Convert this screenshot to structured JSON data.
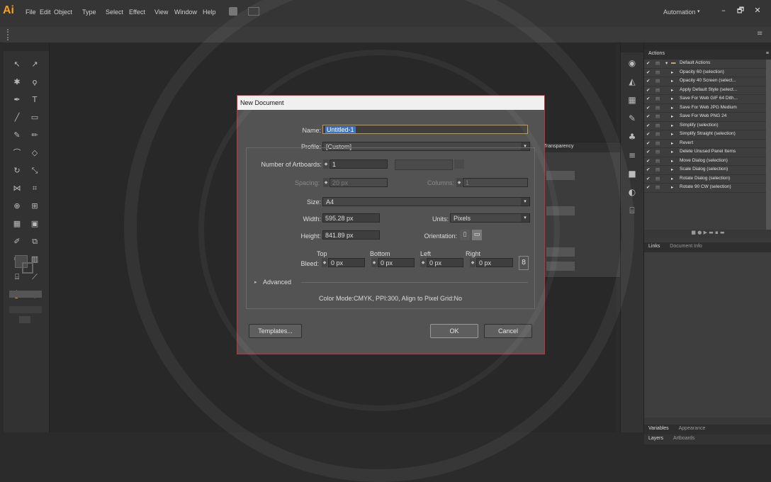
{
  "app": {
    "logo": "Ai",
    "menu": [
      "File",
      "Edit",
      "Object",
      "Type",
      "Select",
      "Effect",
      "View",
      "Window",
      "Help"
    ],
    "workspace": "Automation",
    "window_buttons": [
      "–",
      "🗗",
      "✕"
    ]
  },
  "dialog": {
    "title": "New Document",
    "name_label": "Name:",
    "name_value": "Untitled-1",
    "profile_label": "Profile:",
    "profile_value": "[Custom]",
    "artboards_label": "Number of Artboards:",
    "artboards_value": "1",
    "spacing_label": "Spacing:",
    "spacing_value": "20 px",
    "columns_label": "Columns:",
    "columns_value": "1",
    "size_label": "Size:",
    "size_value": "A4",
    "width_label": "Width:",
    "width_value": "595.28 px",
    "units_label": "Units:",
    "units_value": "Pixels",
    "height_label": "Height:",
    "height_value": "841.89 px",
    "orientation_label": "Orientation:",
    "bleed_label": "Bleed:",
    "bleed_headers": [
      "Top",
      "Bottom",
      "Left",
      "Right"
    ],
    "bleed_values": [
      "0 px",
      "0 px",
      "0 px",
      "0 px"
    ],
    "advanced_label": "Advanced",
    "info": "Color Mode:CMYK, PPI:300, Align to Pixel Grid:No",
    "templates_button": "Templates...",
    "ok_button": "OK",
    "cancel_button": "Cancel"
  },
  "actions_panel": {
    "tab": "Actions",
    "set_name": "Default Actions",
    "items": [
      "Opacity 60 (selection)",
      "Opacity 40 Screen (select...",
      "Apply Default Style (select...",
      "Save For Web GIF 64 Dith...",
      "Save For Web JPG Medium",
      "Save For Web PNG 24",
      "Simplify (selection)",
      "Simplify Straight (selection)",
      "Revert",
      "Delete Unused Panel Items",
      "Move Dialog (selection)",
      "Scale Dialog (selection)",
      "Rotate Dialog (selection)",
      "Rotate 90 CW (selection)"
    ]
  },
  "links_panel": {
    "tabs": [
      "Links",
      "Document Info"
    ]
  },
  "bottom_panel": {
    "tabs": [
      "Variables",
      "Appearance"
    ],
    "tabs2": [
      "Layers",
      "Artboards"
    ]
  },
  "transparency_panel": {
    "tab": "Transparency"
  }
}
